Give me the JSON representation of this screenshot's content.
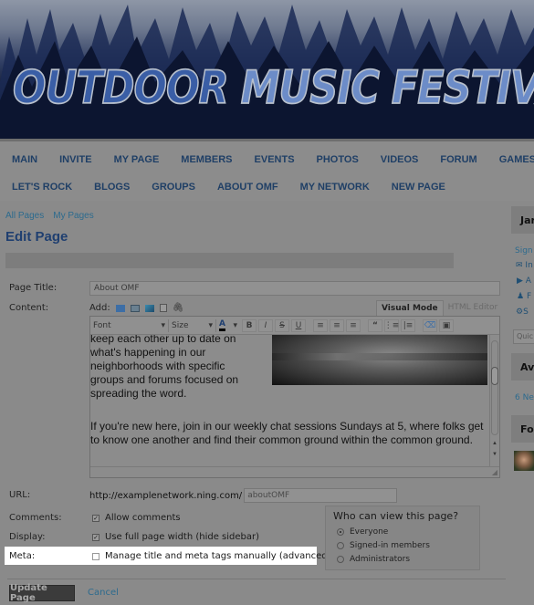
{
  "banner": {
    "title_part1": "OUTDOOR",
    "title_part2": "MUSIC FESTIVALS"
  },
  "nav": {
    "row1": [
      "MAIN",
      "INVITE",
      "MY PAGE",
      "MEMBERS",
      "EVENTS",
      "PHOTOS",
      "VIDEOS",
      "FORUM",
      "GAMES"
    ],
    "row2": [
      "LET'S ROCK",
      "BLOGS",
      "GROUPS",
      "ABOUT OMF",
      "MY NETWORK",
      "NEW PAGE"
    ]
  },
  "breadcrumbs": [
    "All Pages",
    "My Pages"
  ],
  "page": {
    "heading": "Edit Page",
    "labels": {
      "page_title": "Page Title:",
      "content": "Content:",
      "url": "URL:",
      "comments": "Comments:",
      "display": "Display:",
      "meta": "Meta:"
    },
    "page_title_value": "About OMF",
    "add_label": "Add:",
    "add_icons": [
      "link-icon",
      "video-icon",
      "image-icon",
      "file-icon",
      "attachment-icon"
    ],
    "mode_tabs": [
      {
        "label": "Visual Mode",
        "active": true
      },
      {
        "label": "HTML Editor",
        "active": false
      }
    ],
    "toolbar": {
      "font_label": "Font",
      "size_label": "Size",
      "buttons": [
        "text-color",
        "bold",
        "italic",
        "strikethrough",
        "underline",
        "align-left",
        "align-center",
        "align-right",
        "blockquote",
        "bullet-list",
        "numbered-list",
        "eraser",
        "fullscreen"
      ]
    },
    "content": {
      "para1_lines": [
        "keep each other up to date on",
        "what's happening in our",
        "neighborhoods with specific",
        "groups and forums focused on",
        "spreading the word."
      ],
      "para2": "If you're new here, join in our weekly chat sessions Sundays at 5, where folks get to know one another and find their common ground within the common ground."
    },
    "url_prefix": "http://examplenetwork.ning.com/",
    "url_slug": "aboutOMF",
    "allow_comments": {
      "label": "Allow comments",
      "checked": true
    },
    "full_width": {
      "label": "Use full page width (hide sidebar)",
      "checked": true
    },
    "meta_manual": {
      "label": "Manage title and meta tags manually (advanced)",
      "checked": false
    },
    "visibility": {
      "question": "Who can view this page?",
      "options": [
        {
          "label": "Everyone",
          "selected": true
        },
        {
          "label": "Signed-in members",
          "selected": false
        },
        {
          "label": "Administrators",
          "selected": false
        }
      ]
    },
    "update_button": "Update Page",
    "cancel_link": "Cancel"
  },
  "sidebar": {
    "user_box": "Jar",
    "sign_link": "Sign",
    "links": [
      "In",
      "A",
      "F",
      "S"
    ],
    "quick_placeholder": "Quic",
    "box2": "Av",
    "new_link": "6 Ne",
    "box3": "Fo"
  }
}
